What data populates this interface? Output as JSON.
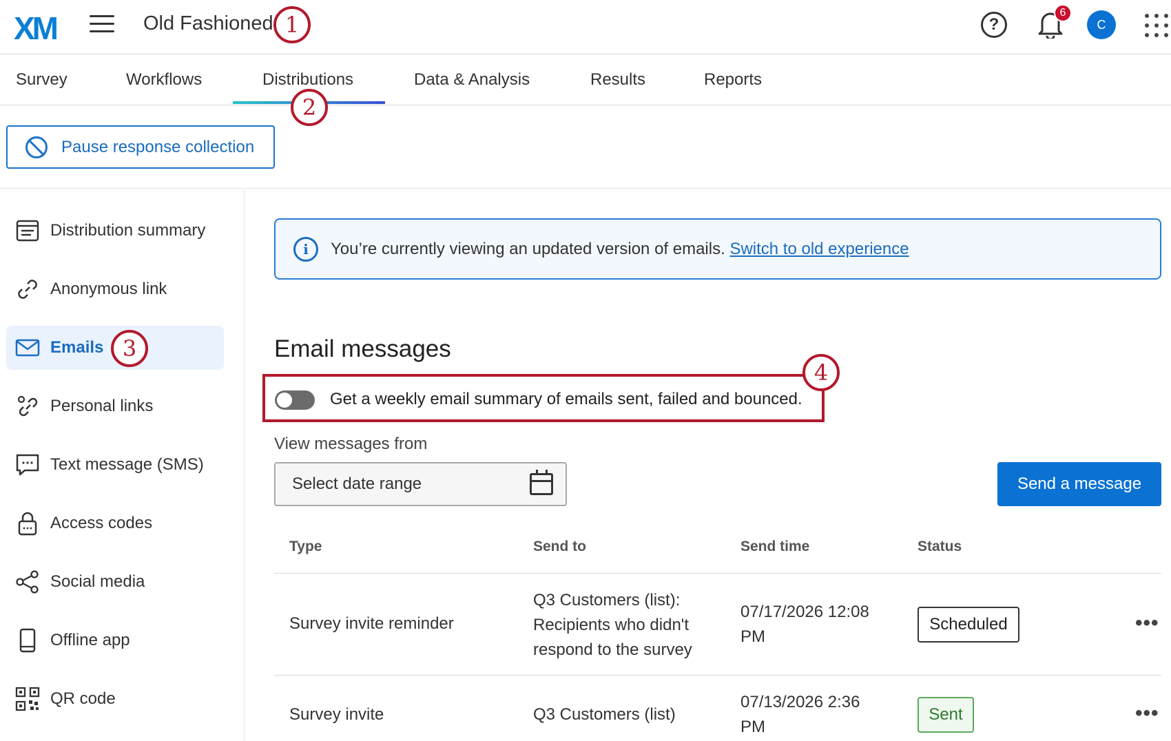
{
  "app": {
    "logo": "XM",
    "survey_name": "Old Fashioned",
    "notification_count": "6",
    "avatar_initial": "C",
    "help_glyph": "?"
  },
  "nav": {
    "tabs": [
      "Survey",
      "Workflows",
      "Distributions",
      "Data & Analysis",
      "Results",
      "Reports"
    ],
    "active": "Distributions"
  },
  "toolbar": {
    "pause_label": "Pause response collection"
  },
  "sidebar": {
    "items": [
      {
        "label": "Distribution summary",
        "icon": "list-icon"
      },
      {
        "label": "Anonymous link",
        "icon": "link-icon"
      },
      {
        "label": "Emails",
        "icon": "envelope-icon"
      },
      {
        "label": "Personal links",
        "icon": "personal-link-icon"
      },
      {
        "label": "Text message (SMS)",
        "icon": "chat-icon"
      },
      {
        "label": "Access codes",
        "icon": "lock-icon"
      },
      {
        "label": "Social media",
        "icon": "share-icon"
      },
      {
        "label": "Offline app",
        "icon": "phone-icon"
      },
      {
        "label": "QR code",
        "icon": "qr-icon"
      }
    ],
    "active": "Emails"
  },
  "info_banner": {
    "text": "You’re currently viewing an updated version of emails.",
    "link": "Switch to old experience"
  },
  "main": {
    "heading": "Email messages",
    "toggle_text": "Get a weekly email summary of emails sent, failed and bounced.",
    "view_label": "View messages from",
    "date_placeholder": "Select date range",
    "send_button": "Send a message"
  },
  "table": {
    "columns": [
      "Type",
      "Send to",
      "Send time",
      "Status"
    ],
    "rows": [
      {
        "type": "Survey invite reminder",
        "send_to": "Q3 Customers (list): Recipients who didn't respond to the survey",
        "send_time": "07/17/2026 12:08 PM",
        "status": "Scheduled"
      },
      {
        "type": "Survey invite",
        "send_to": "Q3 Customers (list)",
        "send_time": "07/13/2026 2:36 PM",
        "status": "Sent"
      }
    ]
  },
  "callouts": [
    "1",
    "2",
    "3",
    "4"
  ],
  "colors": {
    "accent": "#0b72d4",
    "callout": "#b3192c",
    "sent": "#2f7a2f"
  }
}
